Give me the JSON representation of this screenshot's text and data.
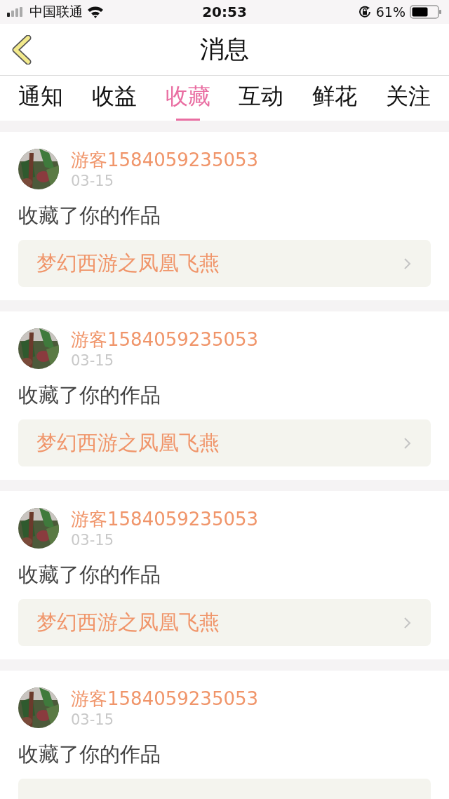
{
  "status_bar": {
    "carrier": "中国联通",
    "time": "20:53",
    "battery": "61%"
  },
  "nav": {
    "title": "消息"
  },
  "tabs": [
    {
      "label": "通知",
      "selected": false
    },
    {
      "label": "收益",
      "selected": false
    },
    {
      "label": "收藏",
      "selected": true
    },
    {
      "label": "互动",
      "selected": false
    },
    {
      "label": "鲜花",
      "selected": false
    },
    {
      "label": "关注",
      "selected": false
    }
  ],
  "messages": [
    {
      "user": "游客1584059235053",
      "date": "03-15",
      "action": "收藏了你的作品",
      "work": "梦幻西游之凤凰飞燕"
    },
    {
      "user": "游客1584059235053",
      "date": "03-15",
      "action": "收藏了你的作品",
      "work": "梦幻西游之凤凰飞燕"
    },
    {
      "user": "游客1584059235053",
      "date": "03-15",
      "action": "收藏了你的作品",
      "work": "梦幻西游之凤凰飞燕"
    },
    {
      "user": "游客1584059235053",
      "date": "03-15",
      "action": "收藏了你的作品"
    }
  ]
}
